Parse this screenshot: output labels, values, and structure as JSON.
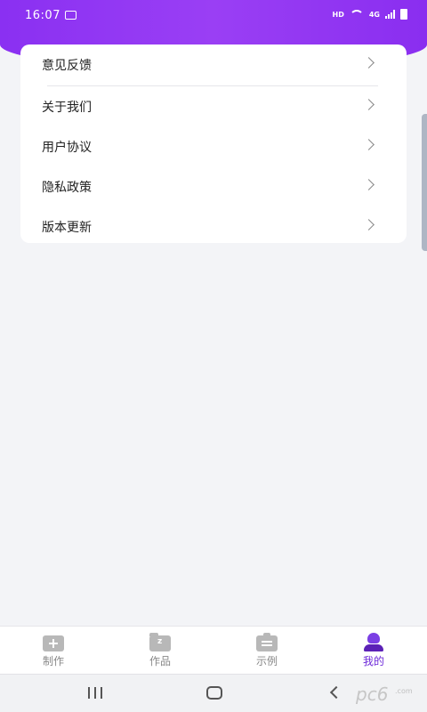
{
  "status": {
    "time": "16:07",
    "hd": "HD",
    "network": "4G"
  },
  "menu": {
    "items": [
      {
        "label": "意见反馈"
      },
      {
        "label": "关于我们"
      },
      {
        "label": "用户协议"
      },
      {
        "label": "隐私政策"
      },
      {
        "label": "版本更新"
      }
    ]
  },
  "tabbar": {
    "tabs": [
      {
        "label": "制作",
        "icon": "plus-card-icon"
      },
      {
        "label": "作品",
        "icon": "folder-icon"
      },
      {
        "label": "示例",
        "icon": "clipboard-icon"
      },
      {
        "label": "我的",
        "icon": "user-icon",
        "active": true
      }
    ]
  },
  "watermark": {
    "main": "pc6",
    "small": ".com"
  },
  "colors": {
    "header": "#8a30f2",
    "accent": "#6d28d9",
    "background": "#f3f4f7"
  }
}
